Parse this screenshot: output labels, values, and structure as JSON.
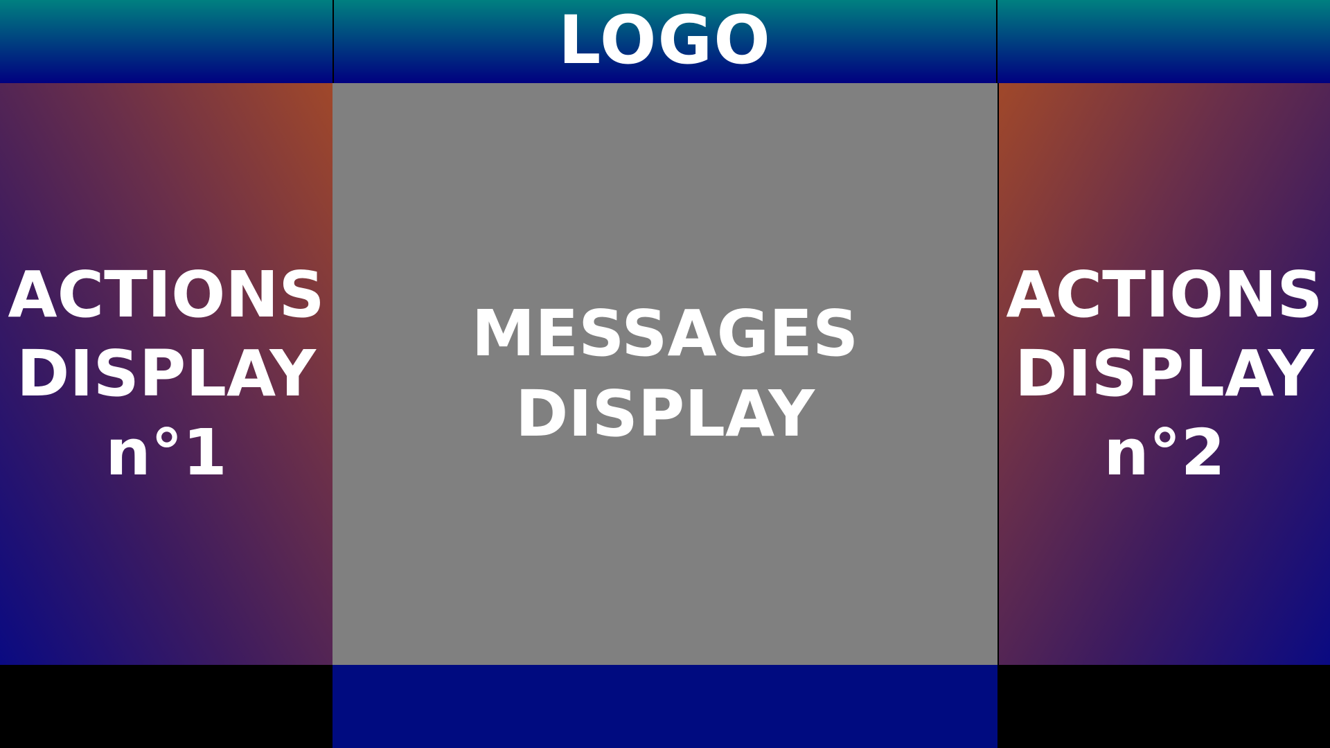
{
  "header": {
    "logo_text": "LOGO"
  },
  "actions_display_1": {
    "lines": [
      "ACTIONS",
      "DISPLAY",
      "n°1"
    ]
  },
  "messages_display": {
    "lines": [
      "MESSAGES",
      "DISPLAY"
    ]
  },
  "actions_display_2": {
    "lines": [
      "ACTIONS",
      "DISPLAY",
      "n°2"
    ]
  },
  "colors": {
    "header_gradient_top": "#008080",
    "header_gradient_bottom": "#000080",
    "actions_gradient_top": "#a0482a",
    "actions_gradient_bottom": "#0a0a82",
    "messages_background": "#808080",
    "footer_center": "#000b80",
    "footer_sides": "#000000",
    "text": "#ffffff"
  }
}
